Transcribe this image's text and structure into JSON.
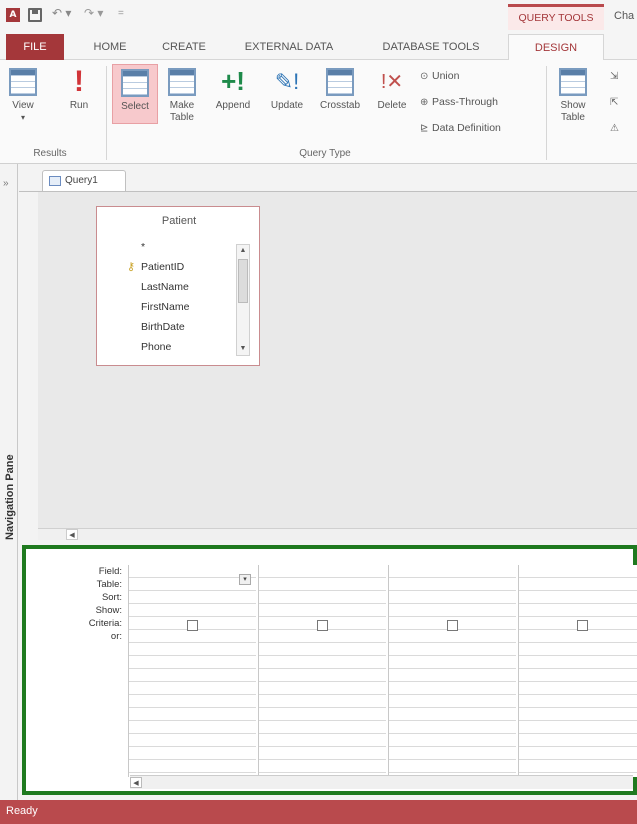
{
  "titlebar": {
    "app_icon": "access-icon",
    "query_tools_label": "QUERY TOOLS",
    "truncated_title": "Cha"
  },
  "ribbon_tabs": {
    "file": "FILE",
    "home": "HOME",
    "create": "CREATE",
    "external": "EXTERNAL DATA",
    "dbtools": "DATABASE TOOLS",
    "design": "DESIGN"
  },
  "ribbon": {
    "results": {
      "view": "View",
      "run": "Run",
      "group_label": "Results"
    },
    "query_type": {
      "select": "Select",
      "make_table_line1": "Make",
      "make_table_line2": "Table",
      "append": "Append",
      "update": "Update",
      "crosstab": "Crosstab",
      "delete": "Delete",
      "union": "Union",
      "pass_through": "Pass-Through",
      "data_definition": "Data Definition",
      "group_label": "Query Type"
    },
    "show_table_line1": "Show",
    "show_table_line2": "Table"
  },
  "nav_pane": {
    "label": "Navigation Pane",
    "collapse": "»"
  },
  "document_tab": {
    "label": "Query1"
  },
  "field_list": {
    "title": "Patient",
    "fields": [
      "*",
      "PatientID",
      "LastName",
      "FirstName",
      "BirthDate",
      "Phone"
    ],
    "key_field_index": 1
  },
  "design_grid": {
    "row_labels": [
      "Field:",
      "Table:",
      "Sort:",
      "Show:",
      "Criteria:",
      "or:"
    ]
  },
  "status": {
    "text": "Ready"
  },
  "colors": {
    "accent": "#a4373a",
    "statusbar": "#b94a4d",
    "highlight_border": "#1f7a1f"
  }
}
